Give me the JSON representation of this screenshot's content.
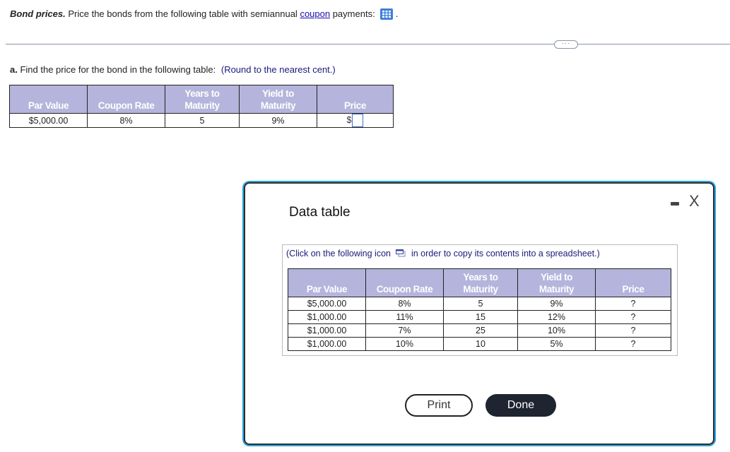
{
  "question": {
    "title": "Bond prices.",
    "text_before_link": " Price the bonds from the following table with semiannual ",
    "link_text": "coupon",
    "text_after_link": " payments: ",
    "trailing": ".",
    "data_icon": "table-grid-icon"
  },
  "more_button": "···",
  "part_a": {
    "label": "a.",
    "text": " Find the price for the bond in the following table: ",
    "hint": "(Round to the nearest cent.)"
  },
  "main_table": {
    "headers": [
      "Par Value",
      "Coupon Rate",
      "Years to\nMaturity",
      "Yield to\nMaturity",
      "Price"
    ],
    "header_lines": [
      [
        "Par Value"
      ],
      [
        "Coupon Rate"
      ],
      [
        "Years to",
        "Maturity"
      ],
      [
        "Yield to",
        "Maturity"
      ],
      [
        "Price"
      ]
    ],
    "row": {
      "par_value": "$5,000.00",
      "coupon_rate": "8%",
      "years": "5",
      "yield": "9%",
      "price_prefix": "$",
      "price_value": ""
    }
  },
  "modal": {
    "title": "Data table",
    "minimize_icon": "minimize-icon",
    "close_label": "X",
    "note_before": "(Click on the following icon",
    "note_after": "in order to copy its contents into a spreadsheet.)",
    "copy_icon": "copy-to-spreadsheet-icon",
    "table": {
      "header_lines": [
        [
          "Par Value"
        ],
        [
          "Coupon Rate"
        ],
        [
          "Years to",
          "Maturity"
        ],
        [
          "Yield to",
          "Maturity"
        ],
        [
          "Price"
        ]
      ],
      "rows": [
        [
          "$5,000.00",
          "8%",
          "5",
          "9%",
          "?"
        ],
        [
          "$1,000.00",
          "11%",
          "15",
          "12%",
          "?"
        ],
        [
          "$1,000.00",
          "7%",
          "25",
          "10%",
          "?"
        ],
        [
          "$1,000.00",
          "10%",
          "10",
          "5%",
          "?"
        ]
      ]
    },
    "print_label": "Print",
    "done_label": "Done"
  },
  "colors": {
    "header_bg": "#b4b4dc",
    "link": "#1a0dab",
    "hint": "#1a1a7a",
    "modal_glow": "#2fa4e0",
    "done_bg": "#1e2430",
    "icon_blue": "#3f7fd9"
  }
}
